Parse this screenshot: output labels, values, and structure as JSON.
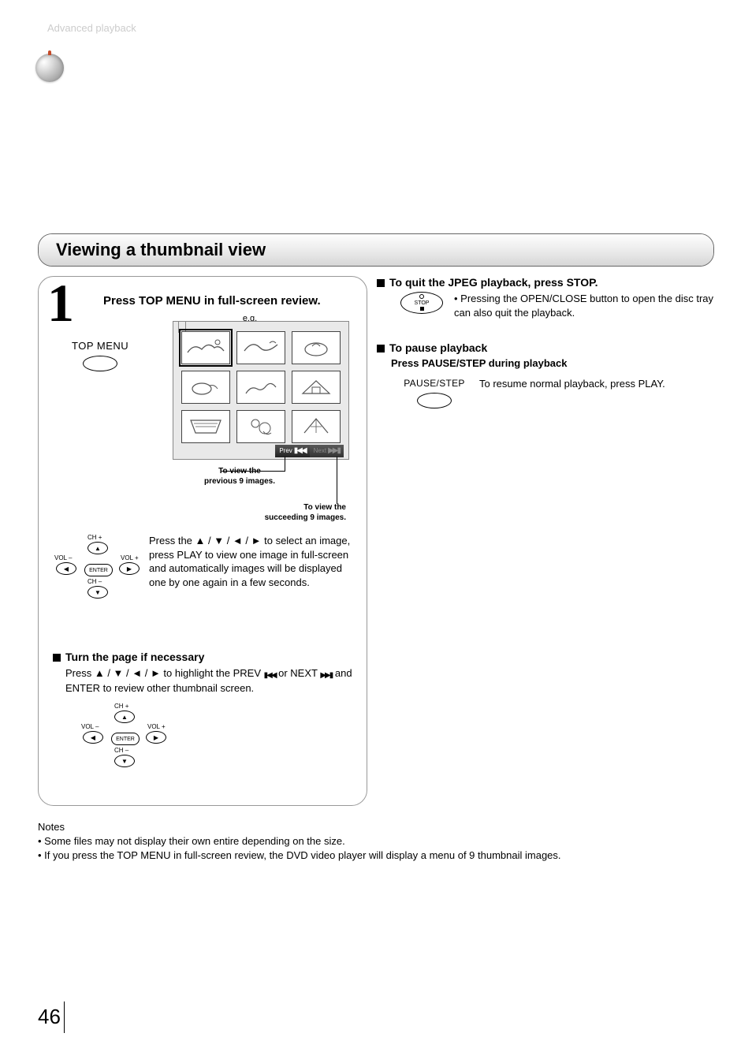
{
  "header": {
    "breadcrumb": "Advanced playback"
  },
  "section_title": "Viewing a thumbnail view",
  "step": {
    "number": "1",
    "title": "Press TOP MENU in full-screen review.",
    "eg": "e.g.",
    "topmenu_label": "TOP MENU",
    "prev_label": "Prev",
    "next_label": "Next",
    "callout_prev_l1": "To view the",
    "callout_prev_l2": "previous 9 images.",
    "callout_next_l1": "To view the",
    "callout_next_l2": "succeeding 9 images.",
    "body": "Press the ▲ / ▼ / ◄ / ► to select an image, press PLAY to view one image in full-screen and automatically images will be displayed one by one again in a few seconds."
  },
  "turnpage": {
    "heading": "Turn the page if necessary",
    "body_pre": "Press  ▲ / ▼ / ◄ / ► to highlight the PREV ",
    "body_mid": " or NEXT ",
    "body_post": " and ENTER to review other thumbnail screen."
  },
  "dpad": {
    "ch_plus": "CH",
    "ch_minus": "CH",
    "vol_plus": "VOL",
    "vol_minus": "VOL",
    "enter": "ENTER"
  },
  "right": {
    "quit_head": "To quit the JPEG playback, press STOP.",
    "quit_body": "Pressing the OPEN/CLOSE button to open the disc tray can also quit the playback.",
    "stop_label": "STOP",
    "pause_head": "To pause playback",
    "pause_sub": "Press PAUSE/STEP during playback",
    "pause_label": "PAUSE/STEP",
    "pause_body": "To resume normal playback, press PLAY."
  },
  "notes": {
    "heading": "Notes",
    "n1": "Some files may not display their own entire depending on the size.",
    "n2": "If you press the TOP MENU in full-screen review, the DVD video player will display a menu of 9 thumbnail images."
  },
  "page_number": "46"
}
